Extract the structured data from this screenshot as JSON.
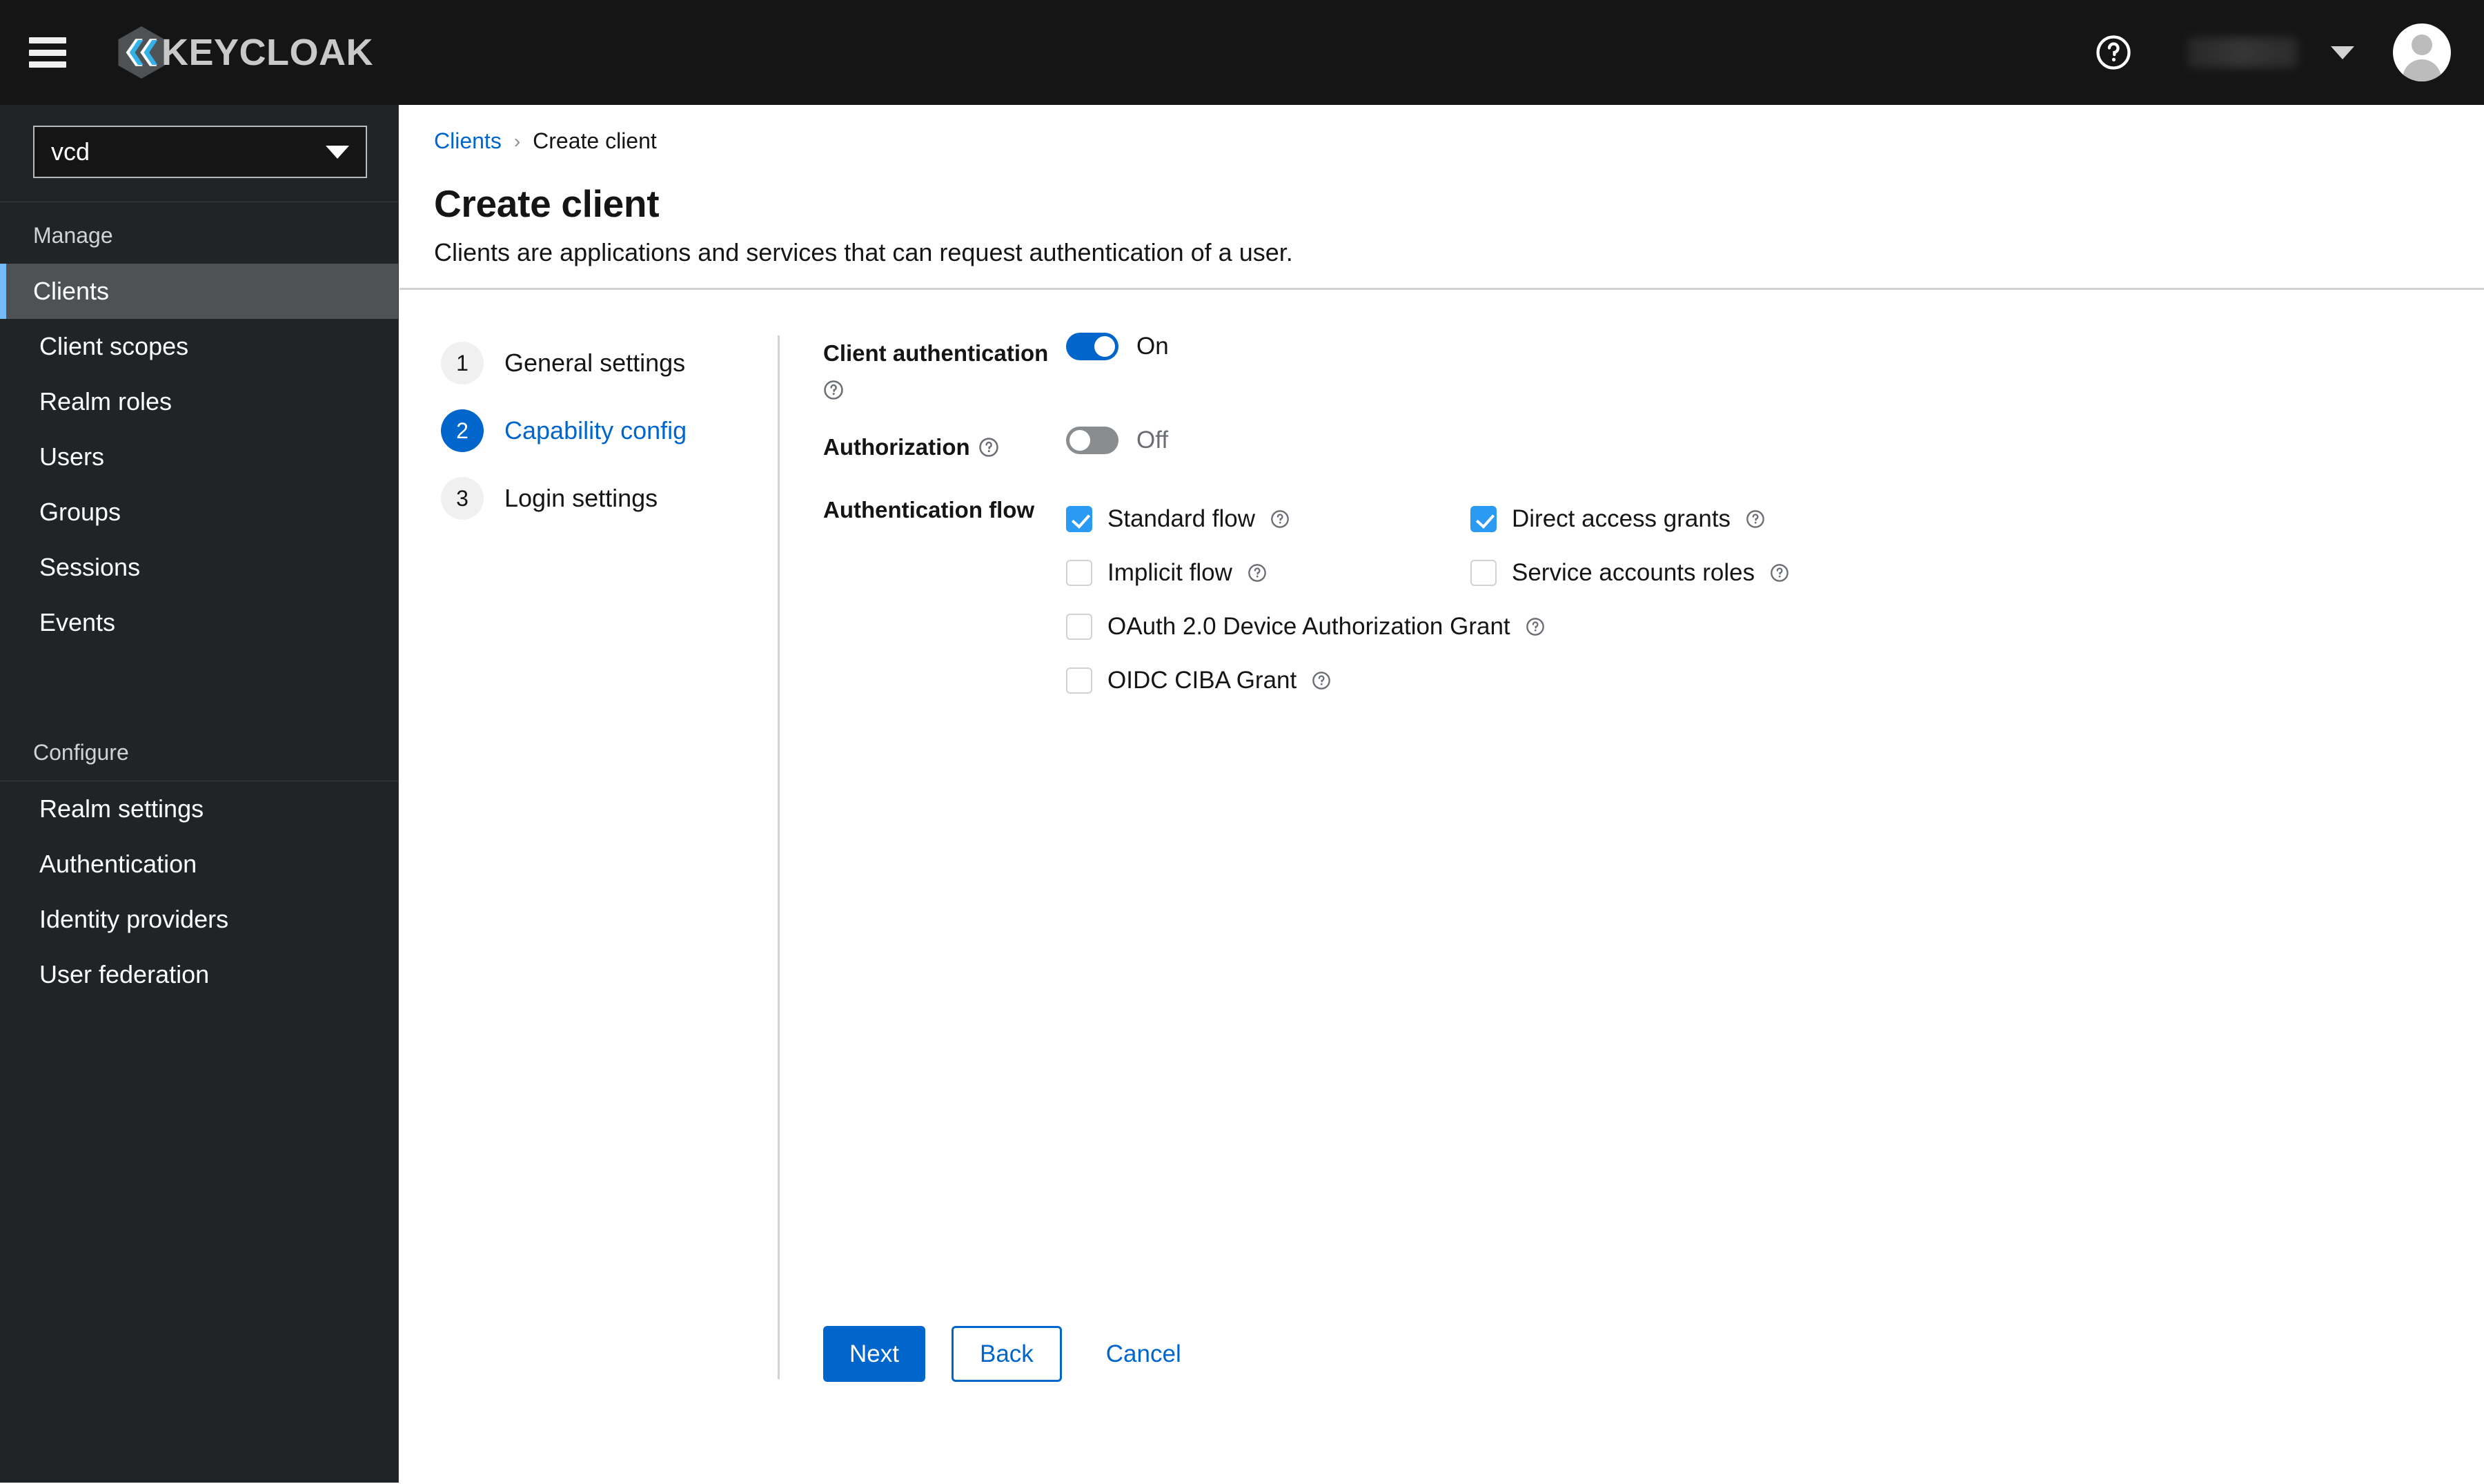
{
  "masthead": {
    "hamburger_label": "Global navigation",
    "brand_text": "KEYCLOAK",
    "help_label": "Help",
    "username": "",
    "avatar_label": "User avatar"
  },
  "sidebar": {
    "realm_select": {
      "value": "vcd",
      "label": "Realm selector"
    },
    "sections": [
      {
        "title": "Manage",
        "items": [
          {
            "label": "Clients",
            "active": true
          },
          {
            "label": "Client scopes",
            "active": false
          },
          {
            "label": "Realm roles",
            "active": false
          },
          {
            "label": "Users",
            "active": false
          },
          {
            "label": "Groups",
            "active": false
          },
          {
            "label": "Sessions",
            "active": false
          },
          {
            "label": "Events",
            "active": false
          }
        ]
      },
      {
        "title": "Configure",
        "items": [
          {
            "label": "Realm settings",
            "active": false
          },
          {
            "label": "Authentication",
            "active": false
          },
          {
            "label": "Identity providers",
            "active": false
          },
          {
            "label": "User federation",
            "active": false
          }
        ]
      }
    ]
  },
  "header": {
    "breadcrumb": {
      "parent": "Clients",
      "separator": "›",
      "current": "Create client"
    },
    "title": "Create client",
    "subtitle": "Clients are applications and services that can request authentication of a user."
  },
  "wizard": {
    "steps": [
      {
        "num": "1",
        "label": "General settings",
        "active": false
      },
      {
        "num": "2",
        "label": "Capability config",
        "active": true
      },
      {
        "num": "3",
        "label": "Login settings",
        "active": false
      }
    ]
  },
  "form": {
    "client_authentication": {
      "label": "Client authentication",
      "state": "On",
      "on": true
    },
    "authorization": {
      "label": "Authorization",
      "state": "Off",
      "on": false
    },
    "authentication_flow": {
      "label": "Authentication flow",
      "options": [
        {
          "label": "Standard flow",
          "checked": true
        },
        {
          "label": "Direct access grants",
          "checked": true
        },
        {
          "label": "Implicit flow",
          "checked": false
        },
        {
          "label": "Service accounts roles",
          "checked": false
        },
        {
          "label": "OAuth 2.0 Device Authorization Grant",
          "checked": false
        },
        {
          "label": "OIDC CIBA Grant",
          "checked": false
        }
      ]
    }
  },
  "footer": {
    "next_label": "Next",
    "back_label": "Back",
    "cancel_label": "Cancel"
  },
  "colors": {
    "accent_blue": "#0066cc",
    "checkbox_blue": "#2b9af3",
    "masthead_bg": "#151515",
    "sidebar_bg": "#212427",
    "sidebar_active_bg": "#4f5255",
    "sidebar_active_border": "#73bcf7",
    "text_dark": "#151515",
    "text_muted": "#6a6e73",
    "border_gray": "#d2d2d2"
  }
}
